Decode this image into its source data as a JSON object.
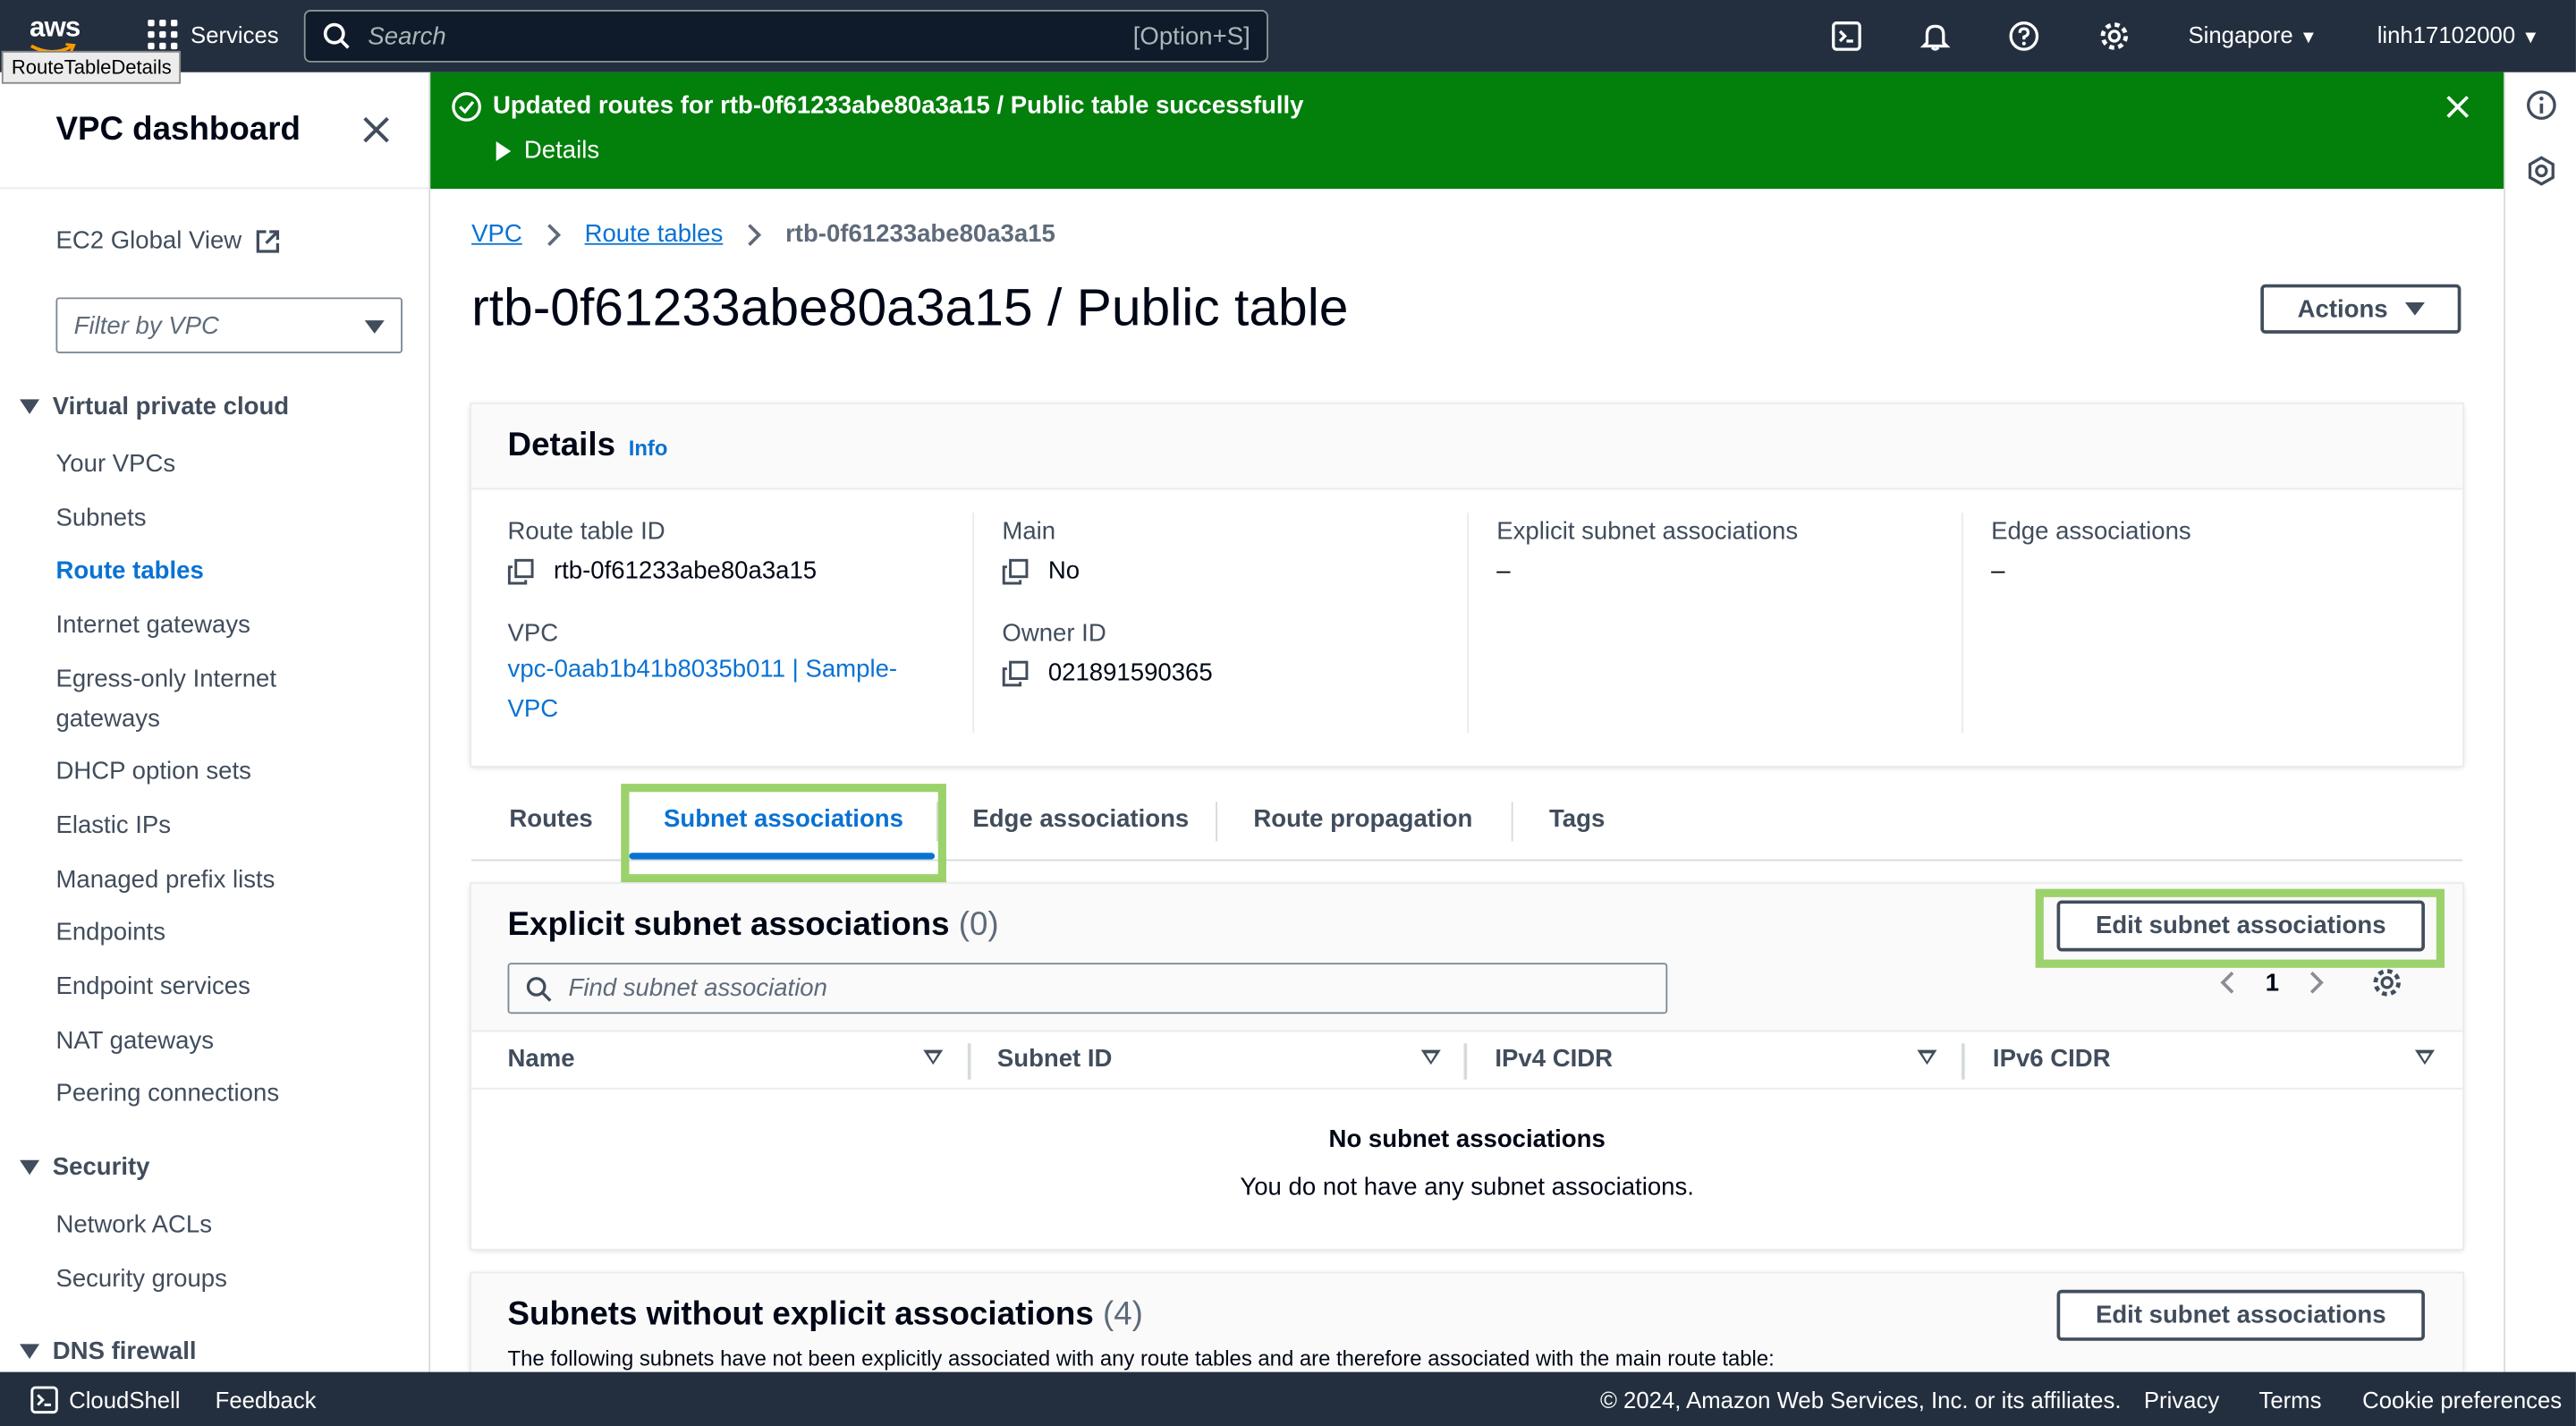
{
  "topnav": {
    "logo_text": "aws",
    "tooltip": "RouteTableDetails",
    "services_label": "Services",
    "search_placeholder": "Search",
    "search_shortcut": "[Option+S]",
    "region": "Singapore",
    "account": "linh17102000",
    "icons": [
      "cloudshell-icon",
      "bell-icon",
      "help-icon",
      "settings-icon"
    ]
  },
  "sidebar": {
    "title": "VPC dashboard",
    "ec2_global_view": "EC2 Global View",
    "filter_placeholder": "Filter by VPC",
    "sections": [
      {
        "title": "Virtual private cloud",
        "items": [
          "Your VPCs",
          "Subnets",
          "Route tables",
          "Internet gateways",
          "Egress-only Internet gateways",
          "DHCP option sets",
          "Elastic IPs",
          "Managed prefix lists",
          "Endpoints",
          "Endpoint services",
          "NAT gateways",
          "Peering connections"
        ]
      },
      {
        "title": "Security",
        "items": [
          "Network ACLs",
          "Security groups"
        ]
      },
      {
        "title": "DNS firewall",
        "items": []
      }
    ],
    "active_item": "Route tables"
  },
  "flash": {
    "message": "Updated routes for rtb-0f61233abe80a3a15 / Public table successfully",
    "details_label": "Details",
    "color": "#037f0c"
  },
  "breadcrumb": [
    "VPC",
    "Route tables",
    "rtb-0f61233abe80a3a15"
  ],
  "page": {
    "title": "rtb-0f61233abe80a3a15 / Public table",
    "actions_label": "Actions"
  },
  "details": {
    "heading": "Details",
    "info_label": "Info",
    "fields": {
      "route_table_id": {
        "label": "Route table ID",
        "value": "rtb-0f61233abe80a3a15"
      },
      "main": {
        "label": "Main",
        "value": "No"
      },
      "explicit": {
        "label": "Explicit subnet associations",
        "value": "–"
      },
      "edge": {
        "label": "Edge associations",
        "value": "–"
      },
      "vpc": {
        "label": "VPC",
        "value": "vpc-0aab1b41b8035b011 | Sample-VPC"
      },
      "owner": {
        "label": "Owner ID",
        "value": "021891590365"
      }
    }
  },
  "tabs": [
    "Routes",
    "Subnet associations",
    "Edge associations",
    "Route propagation",
    "Tags"
  ],
  "active_tab": "Subnet associations",
  "explicit_table": {
    "title": "Explicit subnet associations",
    "count": "(0)",
    "edit_label": "Edit subnet associations",
    "find_placeholder": "Find subnet association",
    "page_number": "1",
    "columns": [
      "Name",
      "Subnet ID",
      "IPv4 CIDR",
      "IPv6 CIDR"
    ],
    "empty_title": "No subnet associations",
    "empty_subtitle": "You do not have any subnet associations."
  },
  "implicit_table": {
    "title": "Subnets without explicit associations",
    "count": "(4)",
    "edit_label": "Edit subnet associations",
    "description": "The following subnets have not been explicitly associated with any route tables and are therefore associated with the main route table:"
  },
  "footer": {
    "cloudshell": "CloudShell",
    "feedback": "Feedback",
    "copyright": "© 2024, Amazon Web Services, Inc. or its affiliates.",
    "links": [
      "Privacy",
      "Terms",
      "Cookie preferences"
    ]
  },
  "highlight_color": "#9bd26b"
}
